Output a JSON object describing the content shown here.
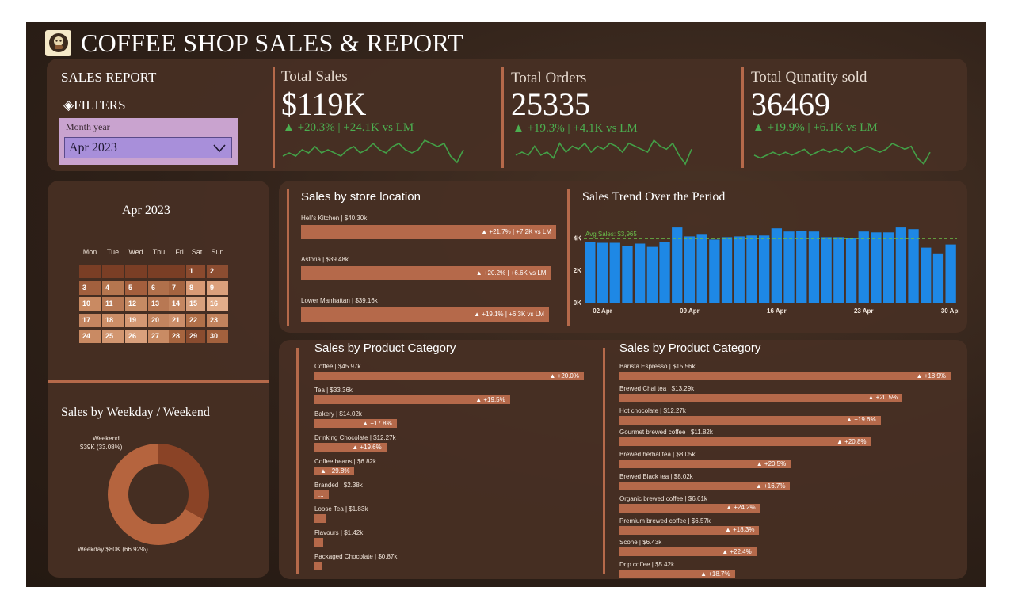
{
  "header": {
    "title": "COFFEE SHOP SALES & REPORT",
    "logo_icon": "coffee-logo-icon"
  },
  "filters": {
    "section_label": "SALES REPORT",
    "filters_label": "FILTERS",
    "slicer_title": "Month year",
    "slicer_value": "Apr 2023"
  },
  "kpis": [
    {
      "label": "Total Sales",
      "value": "$119K",
      "delta": "▲ +20.3% | +24.1K vs LM",
      "spark": [
        8,
        9,
        8,
        10,
        9,
        11,
        9,
        10,
        9,
        8,
        10,
        11,
        9,
        10,
        12,
        10,
        9,
        11,
        12,
        10,
        9,
        10,
        13,
        12,
        11,
        12,
        8,
        6,
        10
      ]
    },
    {
      "label": "Total Orders",
      "value": "25335",
      "delta": "▲ +19.3% | +4.1K vs LM",
      "spark": [
        8,
        9,
        8,
        11,
        8,
        9,
        7,
        12,
        9,
        11,
        10,
        12,
        9,
        11,
        10,
        12,
        11,
        9,
        12,
        11,
        10,
        9,
        13,
        11,
        10,
        12,
        8,
        5,
        10
      ]
    },
    {
      "label": "Total Qunatity sold",
      "value": "36469",
      "delta": "▲ +19.9% | +6.1K vs LM",
      "spark": [
        9,
        8,
        9,
        10,
        9,
        10,
        9,
        10,
        11,
        9,
        10,
        11,
        10,
        11,
        10,
        12,
        10,
        11,
        12,
        11,
        10,
        11,
        13,
        12,
        11,
        12,
        8,
        6,
        10
      ]
    }
  ],
  "calendar": {
    "title": "Apr 2023",
    "weekdays": [
      "Mon",
      "Tue",
      "Wed",
      "Thu",
      "Fri",
      "Sat",
      "Sun"
    ],
    "cells": [
      {
        "d": "",
        "c": "#7a3e25"
      },
      {
        "d": "",
        "c": "#7a3e25"
      },
      {
        "d": "",
        "c": "#7a3e25"
      },
      {
        "d": "",
        "c": "#7a3e25"
      },
      {
        "d": "",
        "c": "#7a3e25"
      },
      {
        "d": "1",
        "c": "#8a4a2e"
      },
      {
        "d": "2",
        "c": "#8c4d31"
      },
      {
        "d": "3",
        "c": "#a2603e"
      },
      {
        "d": "4",
        "c": "#b5764f"
      },
      {
        "d": "5",
        "c": "#a45f3d"
      },
      {
        "d": "6",
        "c": "#b0704b"
      },
      {
        "d": "7",
        "c": "#a56440"
      },
      {
        "d": "8",
        "c": "#d99a75"
      },
      {
        "d": "9",
        "c": "#dba07c"
      },
      {
        "d": "10",
        "c": "#c98a62"
      },
      {
        "d": "11",
        "c": "#b97a55"
      },
      {
        "d": "12",
        "c": "#c58a63"
      },
      {
        "d": "13",
        "c": "#b87853"
      },
      {
        "d": "14",
        "c": "#c48660"
      },
      {
        "d": "15",
        "c": "#d7a07d"
      },
      {
        "d": "16",
        "c": "#e2ad8a"
      },
      {
        "d": "17",
        "c": "#c48560"
      },
      {
        "d": "18",
        "c": "#cc8e67"
      },
      {
        "d": "19",
        "c": "#d49873"
      },
      {
        "d": "20",
        "c": "#c2845e"
      },
      {
        "d": "21",
        "c": "#cb8e69"
      },
      {
        "d": "22",
        "c": "#b07049"
      },
      {
        "d": "23",
        "c": "#c2835d"
      },
      {
        "d": "24",
        "c": "#c98a63"
      },
      {
        "d": "25",
        "c": "#d29670"
      },
      {
        "d": "26",
        "c": "#d9a07c"
      },
      {
        "d": "27",
        "c": "#c98b64"
      },
      {
        "d": "28",
        "c": "#a7653f"
      },
      {
        "d": "29",
        "c": "#8a4c2f"
      },
      {
        "d": "30",
        "c": "#a3613d"
      }
    ]
  },
  "weekday_weekend": {
    "title": "Sales by Weekday / Weekend",
    "weekend_label": "Weekend",
    "weekend_value": "$39K (33.08%)",
    "weekday_label": "Weekday $80K (66.92%)",
    "weekend_share": 33.08,
    "weekday_share": 66.92,
    "colors": {
      "weekend": "#8a4326",
      "weekday": "#b5643e"
    }
  },
  "store_location": {
    "title": "Sales by store location",
    "items": [
      {
        "label": "Hell's Kitchen | $40.30k",
        "delta": "▲ +21.7% | +7.2K vs LM",
        "value": 40.3
      },
      {
        "label": "Astoria | $39.48k",
        "delta": "▲ +20.2% | +6.6K vs LM",
        "value": 39.48
      },
      {
        "label": "Lower Manhattan | $39.16k",
        "delta": "▲ +19.1% | +6.3K vs LM",
        "value": 39.16
      }
    ]
  },
  "trend": {
    "title": "Sales Trend Over the Period",
    "avg_label": "Avg Sales: $3,965",
    "y_ticks": [
      "$4K",
      "$2K",
      "$0K"
    ],
    "x_ticks": [
      "02 Apr",
      "09 Apr",
      "16 Apr",
      "23 Apr",
      "30 Apr"
    ]
  },
  "chart_data": {
    "type": "bar",
    "title": "Sales Trend Over the Period",
    "categories": [
      "01 Apr",
      "02 Apr",
      "03 Apr",
      "04 Apr",
      "05 Apr",
      "06 Apr",
      "07 Apr",
      "08 Apr",
      "09 Apr",
      "10 Apr",
      "11 Apr",
      "12 Apr",
      "13 Apr",
      "14 Apr",
      "15 Apr",
      "16 Apr",
      "17 Apr",
      "18 Apr",
      "19 Apr",
      "20 Apr",
      "21 Apr",
      "22 Apr",
      "23 Apr",
      "24 Apr",
      "25 Apr",
      "26 Apr",
      "27 Apr",
      "28 Apr",
      "29 Apr",
      "30 Apr"
    ],
    "values": [
      3750,
      3700,
      3700,
      3500,
      3650,
      3450,
      3750,
      4650,
      4100,
      4250,
      3900,
      4050,
      4100,
      4150,
      4150,
      4600,
      4400,
      4450,
      4400,
      4050,
      4050,
      4000,
      4400,
      4350,
      4350,
      4650,
      4550,
      3400,
      3050,
      3600
    ],
    "ylim": [
      0,
      5000
    ],
    "avg_line": 3965,
    "color": "#1e88e5"
  },
  "product_category": {
    "title": "Sales by Product Category",
    "items": [
      {
        "label": "Coffee | $45.97k",
        "delta": "▲ +20.0%",
        "value": 45.97
      },
      {
        "label": "Tea | $33.36k",
        "delta": "▲ +19.5%",
        "value": 33.36
      },
      {
        "label": "Bakery | $14.02k",
        "delta": "▲ +17.8%",
        "value": 14.02
      },
      {
        "label": "Drinking Chocolate | $12.27k",
        "delta": "▲ +19.6%",
        "value": 12.27
      },
      {
        "label": "Coffee beans | $6.82k",
        "delta": "▲ +29.8%",
        "value": 6.82
      },
      {
        "label": "Branded | $2.38k",
        "delta": "...",
        "value": 2.38
      },
      {
        "label": "Loose Tea | $1.83k",
        "delta": "",
        "value": 1.83
      },
      {
        "label": "Flavours | $1.42k",
        "delta": "",
        "value": 1.42
      },
      {
        "label": "Packaged Chocolate | $0.87k",
        "delta": "",
        "value": 0.87
      }
    ]
  },
  "product_type": {
    "title": "Sales by Product Category",
    "items": [
      {
        "label": "Barista Espresso | $15.56k",
        "delta": "▲ +18.9%",
        "value": 15.56
      },
      {
        "label": "Brewed Chai tea | $13.29k",
        "delta": "▲ +20.5%",
        "value": 13.29
      },
      {
        "label": "Hot chocolate | $12.27k",
        "delta": "▲ +19.6%",
        "value": 12.27
      },
      {
        "label": "Gourmet brewed coffee | $11.82k",
        "delta": "▲ +20.8%",
        "value": 11.82
      },
      {
        "label": "Brewed herbal tea | $8.05k",
        "delta": "▲ +20.5%",
        "value": 8.05
      },
      {
        "label": "Brewed Black tea | $8.02k",
        "delta": "▲ +16.7%",
        "value": 8.02
      },
      {
        "label": "Organic brewed coffee | $6.61k",
        "delta": "▲ +24.2%",
        "value": 6.61
      },
      {
        "label": "Premium brewed coffee | $6.57k",
        "delta": "▲ +18.3%",
        "value": 6.57
      },
      {
        "label": "Scone | $6.43k",
        "delta": "▲ +22.4%",
        "value": 6.43
      },
      {
        "label": "Drip coffee | $5.42k",
        "delta": "▲ +18.7%",
        "value": 5.42
      }
    ]
  }
}
